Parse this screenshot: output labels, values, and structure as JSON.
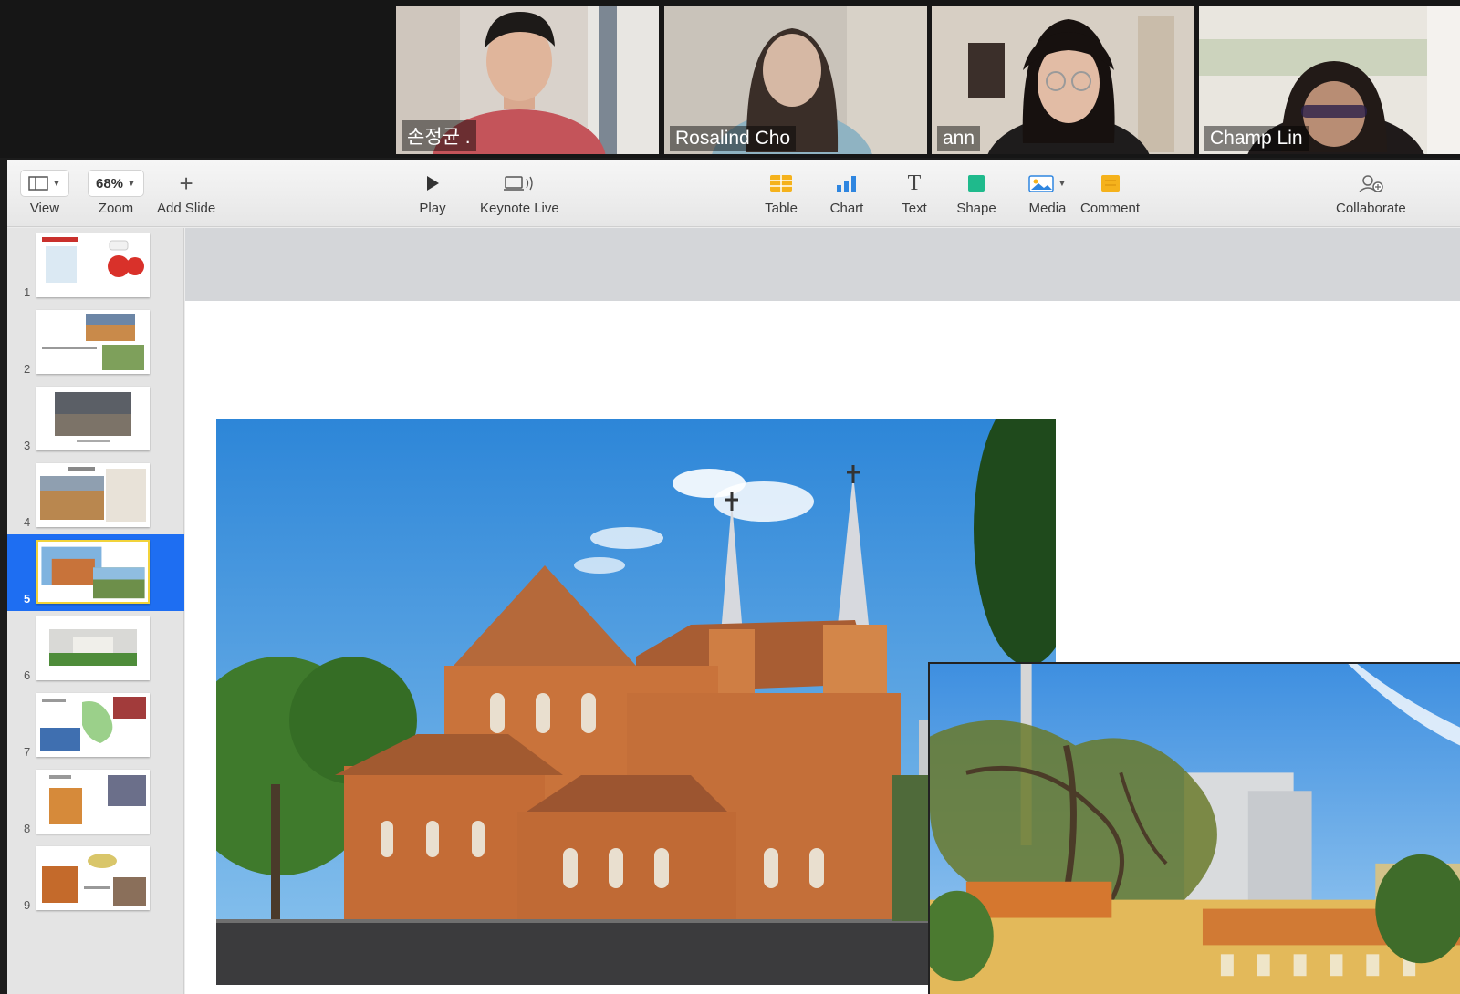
{
  "participants": [
    {
      "name": "손정균 ."
    },
    {
      "name": "Rosalind Cho"
    },
    {
      "name": "ann"
    },
    {
      "name": "Champ Lin"
    }
  ],
  "toolbar": {
    "view": {
      "label": "View",
      "icon": "view-sidebar-icon"
    },
    "zoom": {
      "label": "Zoom",
      "value": "68%"
    },
    "add_slide": {
      "label": "Add Slide",
      "icon": "plus-icon"
    },
    "play": {
      "label": "Play",
      "icon": "play-icon"
    },
    "keynote_live": {
      "label": "Keynote Live",
      "icon": "keynote-live-icon"
    },
    "table": {
      "label": "Table",
      "icon": "table-icon"
    },
    "chart": {
      "label": "Chart",
      "icon": "chart-icon"
    },
    "text": {
      "label": "Text",
      "icon": "text-icon",
      "glyph": "T"
    },
    "shape": {
      "label": "Shape",
      "icon": "shape-icon"
    },
    "media": {
      "label": "Media",
      "icon": "media-icon"
    },
    "comment": {
      "label": "Comment",
      "icon": "comment-icon"
    },
    "collaborate": {
      "label": "Collaborate",
      "icon": "collaborate-icon"
    }
  },
  "navigator": {
    "selected": 5,
    "slides": [
      {
        "number": "1"
      },
      {
        "number": "2"
      },
      {
        "number": "3"
      },
      {
        "number": "4"
      },
      {
        "number": "5"
      },
      {
        "number": "6"
      },
      {
        "number": "7"
      },
      {
        "number": "8"
      },
      {
        "number": "9"
      }
    ]
  },
  "colors": {
    "selection": "#1e6ef2",
    "active_speaker": "#b6c32f",
    "thumb_highlight": "#f2d33a"
  }
}
